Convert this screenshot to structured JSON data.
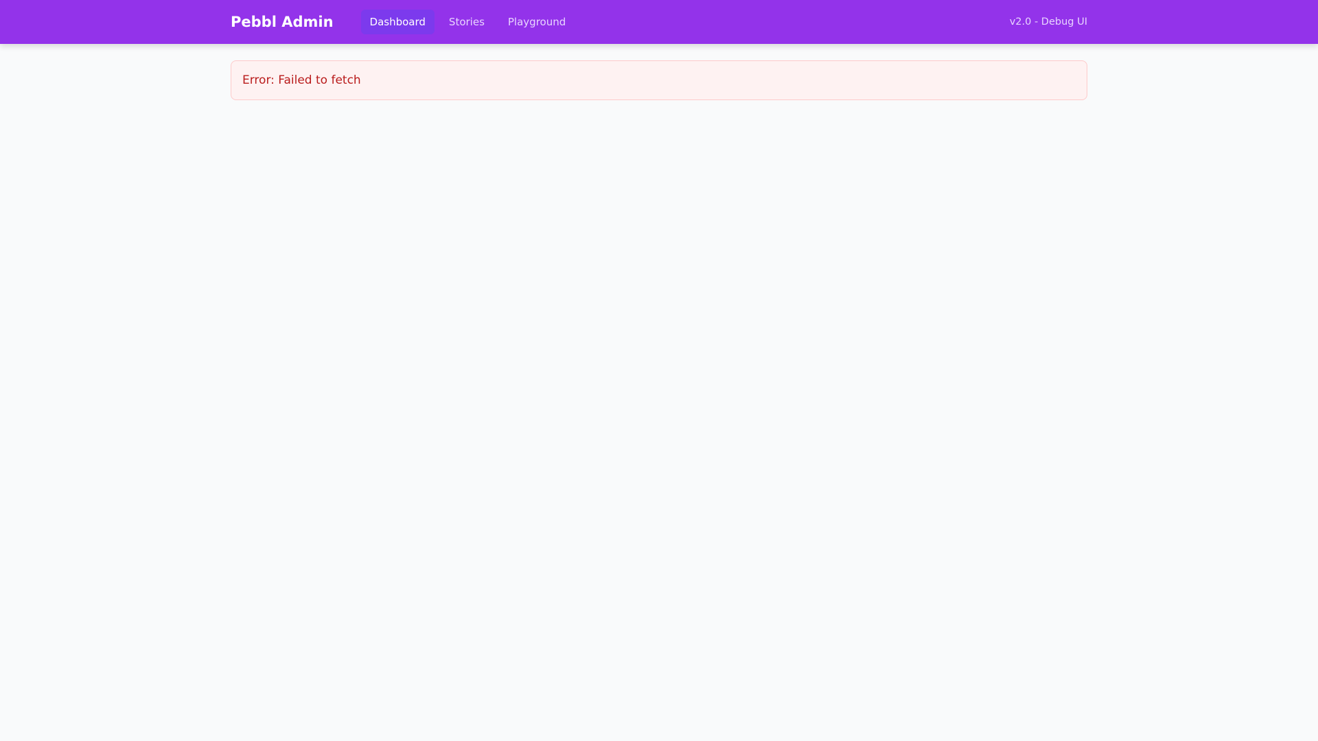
{
  "header": {
    "title": "Pebbl Admin",
    "nav": [
      {
        "label": "Dashboard",
        "active": true
      },
      {
        "label": "Stories"
      },
      {
        "label": "Playground"
      }
    ],
    "version": "v2.0 - Debug UI"
  },
  "main": {
    "error": "Error: Failed to fetch"
  },
  "colors": {
    "header_bg": "#9333ea",
    "active_tab": "#7c3aed",
    "error_text": "#b91c1c",
    "error_bg": "#fef2f2"
  }
}
